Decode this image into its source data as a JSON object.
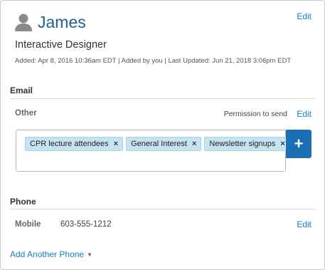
{
  "contact": {
    "name": "James",
    "title": "Interactive Designer",
    "meta": "Added: Apr 8, 2016 10:36am EDT | Added by you | Last Updated: Jun 21, 2018 3:06pm EDT",
    "edit_label": "Edit"
  },
  "email": {
    "section_title": "Email",
    "type_label": "Other",
    "permission_text": "Permission to send",
    "edit_label": "Edit",
    "tags": [
      {
        "label": "CPR lecture attendees",
        "remove": "×"
      },
      {
        "label": "General Interest",
        "remove": "×"
      },
      {
        "label": "Newsletter signups",
        "remove": "×"
      }
    ],
    "add_symbol": "+"
  },
  "phone": {
    "section_title": "Phone",
    "type_label": "Mobile",
    "number": "603-555-1212",
    "edit_label": "Edit",
    "add_another_label": "Add Another Phone"
  },
  "colors": {
    "link": "#1a7cc1",
    "name": "#1f5f94",
    "tag_bg": "#c6e3f2",
    "add_button": "#1a6fb5"
  },
  "icons": {
    "avatar": "person-silhouette-icon",
    "remove_tag": "close-icon",
    "add": "plus-icon",
    "dropdown": "caret-down-icon"
  }
}
